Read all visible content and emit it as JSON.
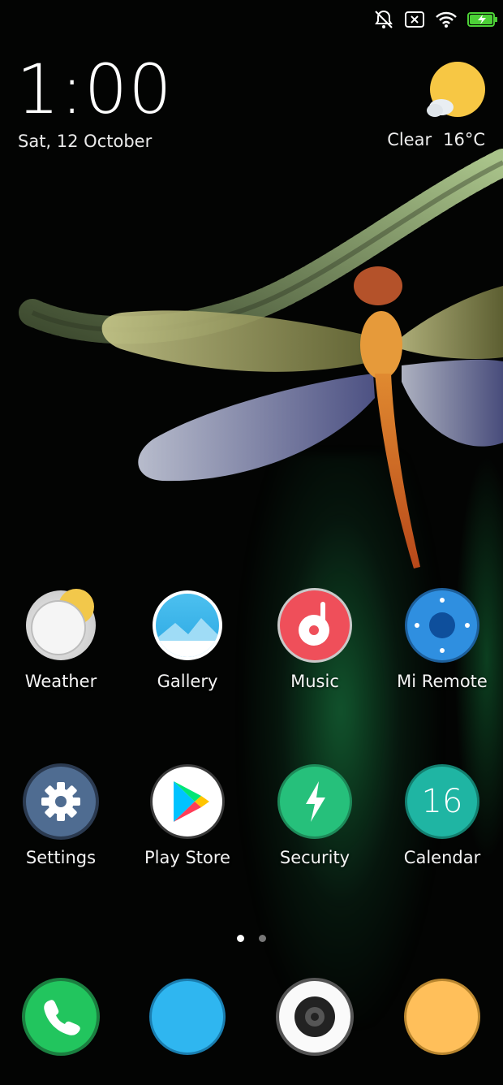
{
  "status_bar": {
    "icons": [
      "mute-bell-icon",
      "sim-error-icon",
      "wifi-icon",
      "battery-charging-icon"
    ],
    "colors": {
      "battery": "#4cd137"
    }
  },
  "clock": {
    "time": "1:00",
    "date": "Sat, 12 October"
  },
  "weather_widget": {
    "condition": "Clear",
    "temperature": "16°C"
  },
  "apps_row1": [
    {
      "label": "Weather",
      "icon": "weather-icon"
    },
    {
      "label": "Gallery",
      "icon": "gallery-icon"
    },
    {
      "label": "Music",
      "icon": "music-icon"
    },
    {
      "label": "Mi Remote",
      "icon": "remote-icon"
    }
  ],
  "apps_row2": [
    {
      "label": "Settings",
      "icon": "gear-icon"
    },
    {
      "label": "Play Store",
      "icon": "play-store-icon"
    },
    {
      "label": "Security",
      "icon": "security-icon"
    },
    {
      "label": "Calendar",
      "icon": "calendar-icon",
      "badge": "16"
    }
  ],
  "page_indicator": {
    "pages": 2,
    "current": 1
  },
  "dock": [
    {
      "icon": "phone-icon"
    },
    {
      "icon": "messages-icon"
    },
    {
      "icon": "camera-icon"
    },
    {
      "icon": "notes-icon"
    }
  ]
}
